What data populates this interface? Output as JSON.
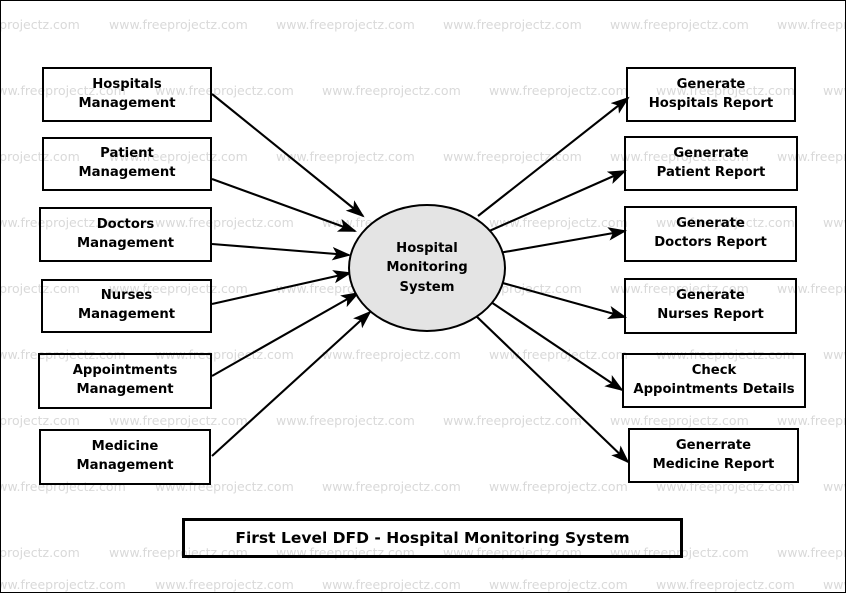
{
  "diagram": {
    "type": "data-flow-diagram",
    "level": "First Level DFD",
    "caption": "First Level DFD - Hospital Monitoring System",
    "watermark_text": "www.freeprojectz.com",
    "colors": {
      "process_fill": "#e4e4e4",
      "stroke": "#000000",
      "background": "#ffffff",
      "watermark": "#d9d9d9"
    }
  },
  "process": {
    "id": "hospital-monitoring-system",
    "label": "Hospital\nMonitoring\nSystem",
    "shape": "circle"
  },
  "inputs": [
    {
      "id": "hospitals-management",
      "label": "Hospitals\nManagement"
    },
    {
      "id": "patient-management",
      "label": "Patient\nManagement"
    },
    {
      "id": "doctors-management",
      "label": "Doctors\nManagement"
    },
    {
      "id": "nurses-management",
      "label": "Nurses\nManagement"
    },
    {
      "id": "appointments-management",
      "label": "Appointments\nManagement"
    },
    {
      "id": "medicine-management",
      "label": "Medicine\nManagement"
    }
  ],
  "outputs": [
    {
      "id": "generate-hospitals-report",
      "label": "Generate\nHospitals Report"
    },
    {
      "id": "generate-patient-report",
      "label": "Generrate\nPatient Report"
    },
    {
      "id": "generate-doctors-report",
      "label": "Generate\nDoctors Report"
    },
    {
      "id": "generate-nurses-report",
      "label": "Generate\nNurses Report"
    },
    {
      "id": "check-appointments-details",
      "label": "Check\nAppointments Details"
    },
    {
      "id": "generate-medicine-report",
      "label": "Generrate\nMedicine Report"
    }
  ],
  "flows": [
    {
      "from": "hospitals-management",
      "to": "hospital-monitoring-system"
    },
    {
      "from": "patient-management",
      "to": "hospital-monitoring-system"
    },
    {
      "from": "doctors-management",
      "to": "hospital-monitoring-system"
    },
    {
      "from": "nurses-management",
      "to": "hospital-monitoring-system"
    },
    {
      "from": "appointments-management",
      "to": "hospital-monitoring-system"
    },
    {
      "from": "medicine-management",
      "to": "hospital-monitoring-system"
    },
    {
      "from": "hospital-monitoring-system",
      "to": "generate-hospitals-report"
    },
    {
      "from": "hospital-monitoring-system",
      "to": "generate-patient-report"
    },
    {
      "from": "hospital-monitoring-system",
      "to": "generate-doctors-report"
    },
    {
      "from": "hospital-monitoring-system",
      "to": "generate-nurses-report"
    },
    {
      "from": "hospital-monitoring-system",
      "to": "check-appointments-details"
    },
    {
      "from": "hospital-monitoring-system",
      "to": "generate-medicine-report"
    }
  ]
}
